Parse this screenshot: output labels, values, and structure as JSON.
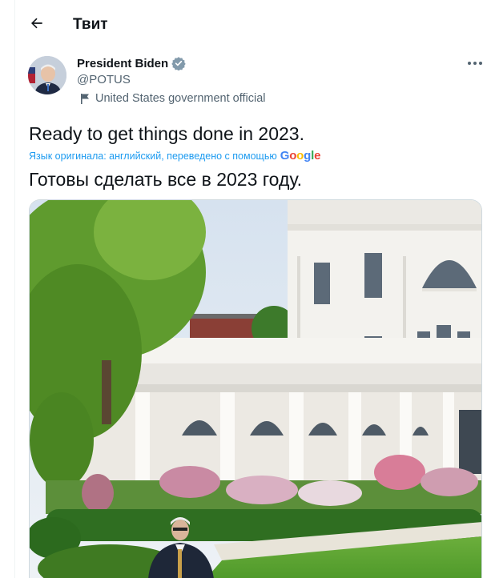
{
  "header": {
    "title": "Твит"
  },
  "tweet": {
    "author": {
      "display_name": "President Biden",
      "handle": "@POTUS",
      "label": "United States government official"
    },
    "text": "Ready to get things done in 2023.",
    "translation": {
      "note": "Язык оригинала: английский, переведено с помощью",
      "provider": "Google",
      "text": "Готовы сделать все в 2023 году."
    }
  },
  "colors": {
    "accent": "#1d9bf0",
    "verified": "#829aab",
    "secondary_text": "#536471"
  },
  "icons": {
    "back": "arrow-left-icon",
    "verified": "verified-badge-icon",
    "label": "flag-icon",
    "more": "more-dots-icon"
  }
}
